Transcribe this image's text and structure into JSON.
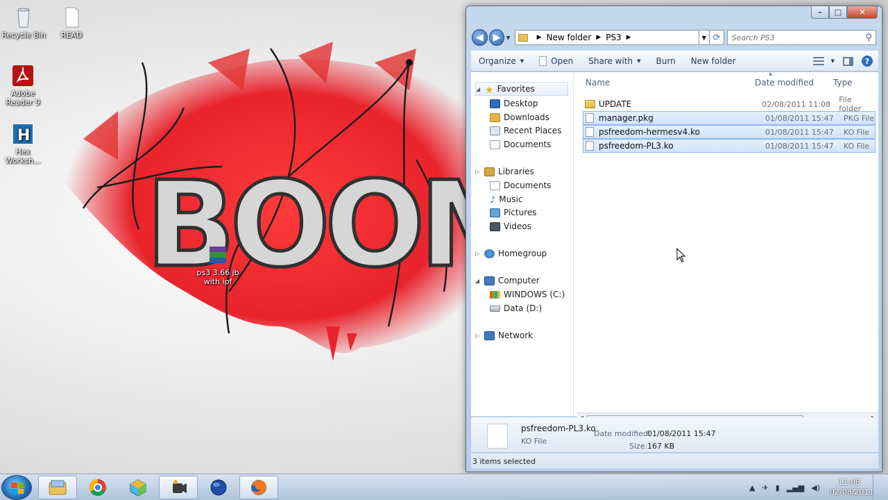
{
  "desktop": {
    "icons": [
      {
        "label": "Recycle Bin"
      },
      {
        "label": "READ"
      },
      {
        "label": "Adobe\nReader 9"
      },
      {
        "label": "Hex\nWorksh..."
      },
      {
        "label": "ps3 3.66 jb\nwith ipf"
      }
    ],
    "wallpaper_text": "BOOM"
  },
  "explorer": {
    "caption_buttons": {
      "minimize": "–",
      "maximize": "□",
      "close": "✕"
    },
    "address": {
      "crumbs": [
        "New folder",
        "PS3"
      ]
    },
    "search": {
      "placeholder": "Search PS3"
    },
    "toolbar": {
      "organize": "Organize",
      "open": "Open",
      "share_with": "Share with",
      "burn": "Burn",
      "new_folder": "New folder"
    },
    "nav": {
      "favorites": "Favorites",
      "desktop": "Desktop",
      "downloads": "Downloads",
      "recent_places": "Recent Places",
      "documents": "Documents",
      "libraries": "Libraries",
      "lib_documents": "Documents",
      "music": "Music",
      "pictures": "Pictures",
      "videos": "Videos",
      "homegroup": "Homegroup",
      "computer": "Computer",
      "drive_c": "WINDOWS (C:)",
      "drive_d": "Data (D:)",
      "network": "Network"
    },
    "columns": {
      "name": "Name",
      "date": "Date modified",
      "type": "Type"
    },
    "files": [
      {
        "name": "UPDATE",
        "date": "02/08/2011 11:08",
        "type": "File folder",
        "selected": false
      },
      {
        "name": "manager.pkg",
        "date": "01/08/2011 15:47",
        "type": "PKG File",
        "selected": true
      },
      {
        "name": "psfreedom-hermesv4.ko",
        "date": "01/08/2011 15:47",
        "type": "KO File",
        "selected": true
      },
      {
        "name": "psfreedom-PL3.ko",
        "date": "01/08/2011 15:47",
        "type": "KO File",
        "selected": true
      }
    ],
    "details": {
      "name": "psfreedom-PL3.ko",
      "type": "KO File",
      "date_label": "Date modified:",
      "date_value": "01/08/2011 15:47",
      "size_label": "Size:",
      "size_value": "167 KB"
    },
    "status": "3 items selected"
  },
  "taskbar": {
    "apps": [
      "explorer-icon",
      "chrome-icon",
      "game-icon",
      "video-icon",
      "globe-icon",
      "firefox-icon"
    ],
    "clock": {
      "time": "11:08",
      "date": "02/08/2011"
    }
  },
  "colors": {
    "accent": "#2b5fa6",
    "selection": "#cfe3fb",
    "wallpaper_red": "#e8232c"
  }
}
